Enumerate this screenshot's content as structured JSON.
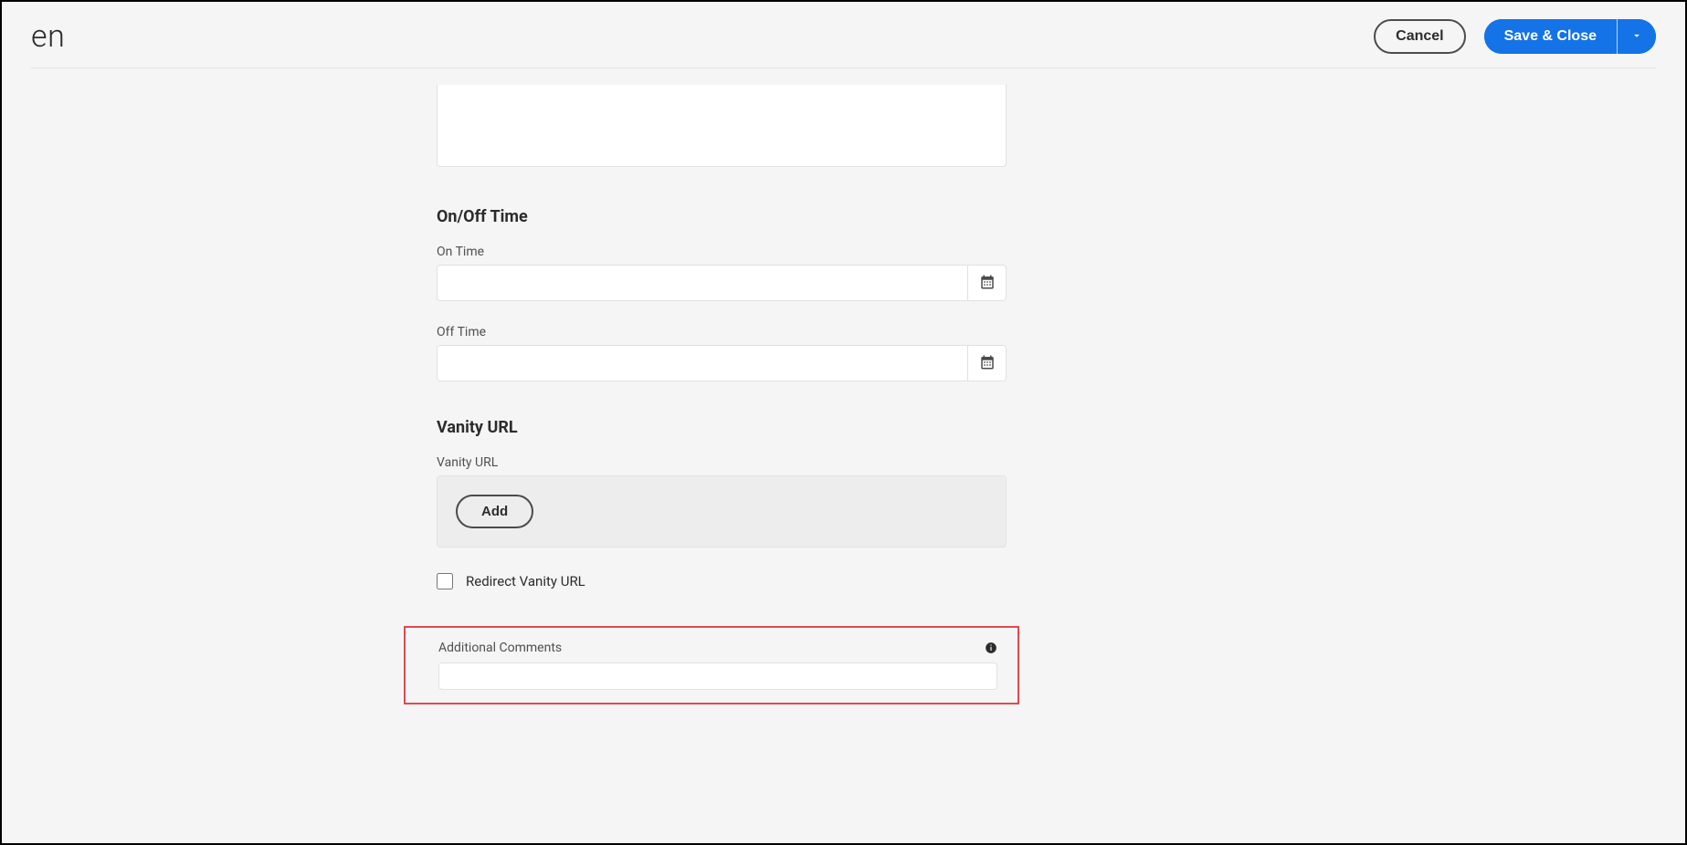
{
  "header": {
    "title": "en",
    "cancel_label": "Cancel",
    "save_label": "Save & Close"
  },
  "onoff": {
    "heading": "On/Off Time",
    "on_label": "On Time",
    "on_value": "",
    "off_label": "Off Time",
    "off_value": ""
  },
  "vanity": {
    "heading": "Vanity URL",
    "field_label": "Vanity URL",
    "add_label": "Add",
    "redirect_label": "Redirect Vanity URL",
    "redirect_checked": false
  },
  "comments": {
    "label": "Additional Comments",
    "value": ""
  }
}
